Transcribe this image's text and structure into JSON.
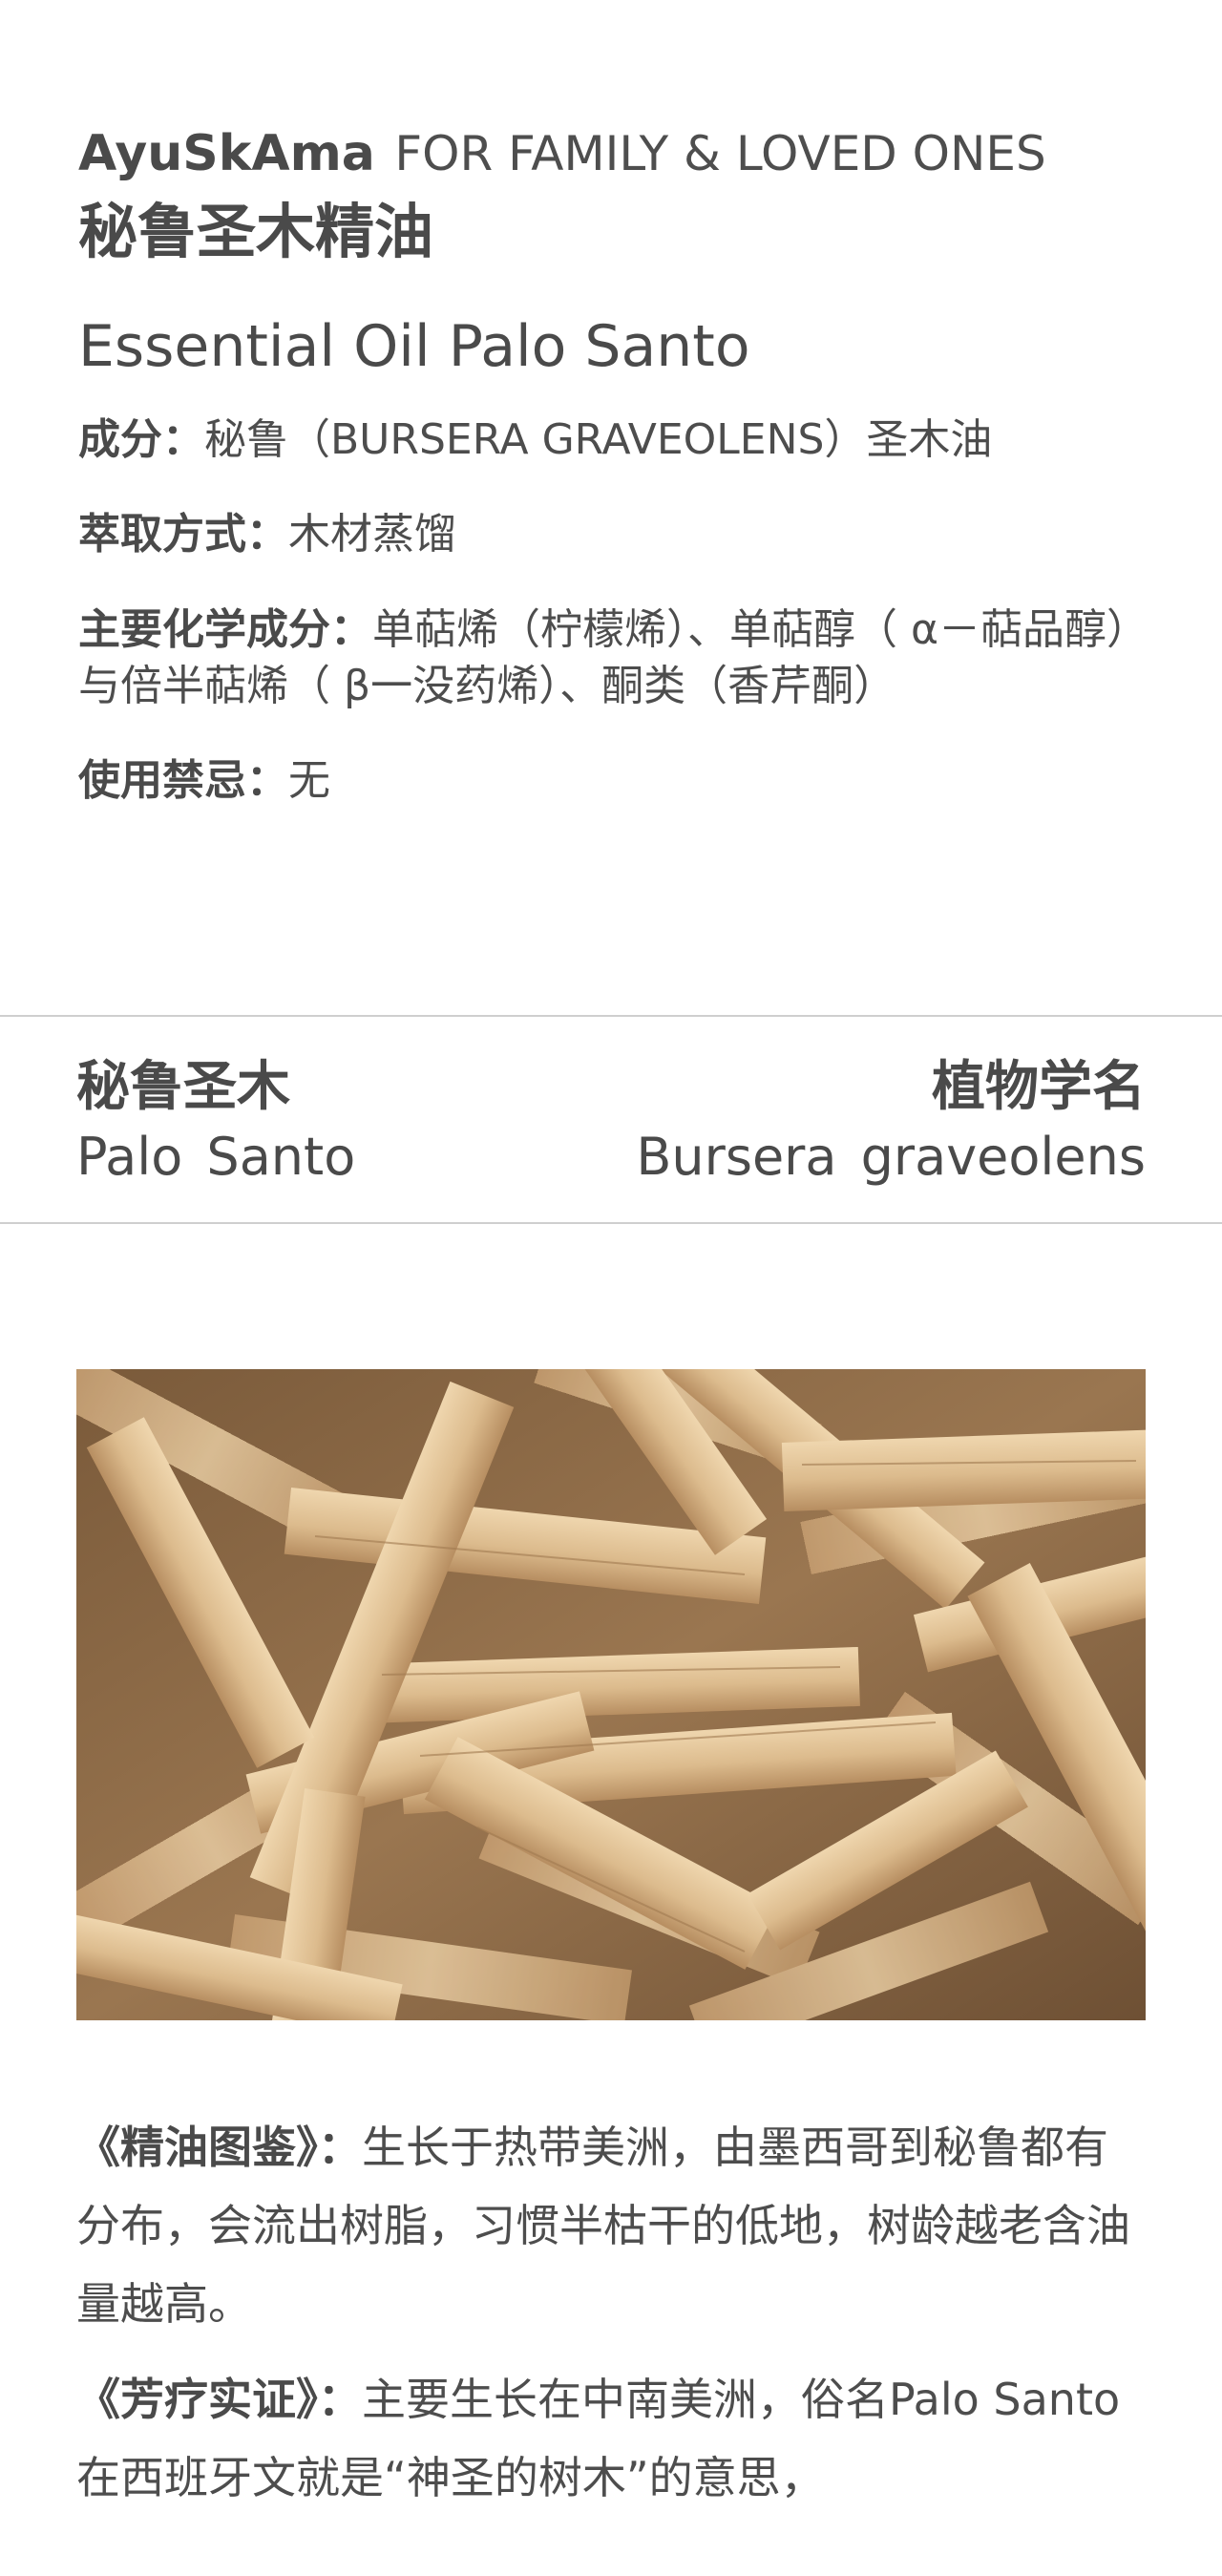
{
  "header": {
    "brand": "AyuSkAma",
    "tagline": "FOR FAMILY & LOVED ONES",
    "title_cn": "秘鲁圣木精油",
    "title_en": "Essential Oil Palo Santo"
  },
  "info": {
    "ingredient_label": "成分：",
    "ingredient_value": "秘鲁（BURSERA GRAVEOLENS）圣木油",
    "extraction_label": "萃取方式：",
    "extraction_value": "木材蒸馏",
    "chemical_label": "主要化学成分：",
    "chemical_value": "单萜烯（柠檬烯）、单萜醇（ α－萜品醇）与倍半萜烯（ β一没药烯）、酮类（香芹酮）",
    "contraindication_label": "使用禁忌：",
    "contraindication_value": "无"
  },
  "names": {
    "common_cn": "秘鲁圣木",
    "common_en": "Palo Santo",
    "botanical_cn": "植物学名",
    "botanical_en": "Bursera graveolens"
  },
  "photo": {
    "colors": {
      "background": "#8a6a48",
      "wood_light": "#e6c9a0",
      "wood_mid": "#d3b185",
      "wood_dark": "#b38a5e"
    }
  },
  "body": {
    "atlas_label": "《精油图鉴》：",
    "atlas_text": "生长于热带美洲，由墨西哥到秘鲁都有分布，会流出树脂，习惯半枯干的低地，树龄越老含油量越高。",
    "aroma_label": "《芳疗实证》：",
    "aroma_text": "主要生长在中南美洲，俗名Palo Santo 在西班牙文就是“神圣的树木”的意思，"
  }
}
